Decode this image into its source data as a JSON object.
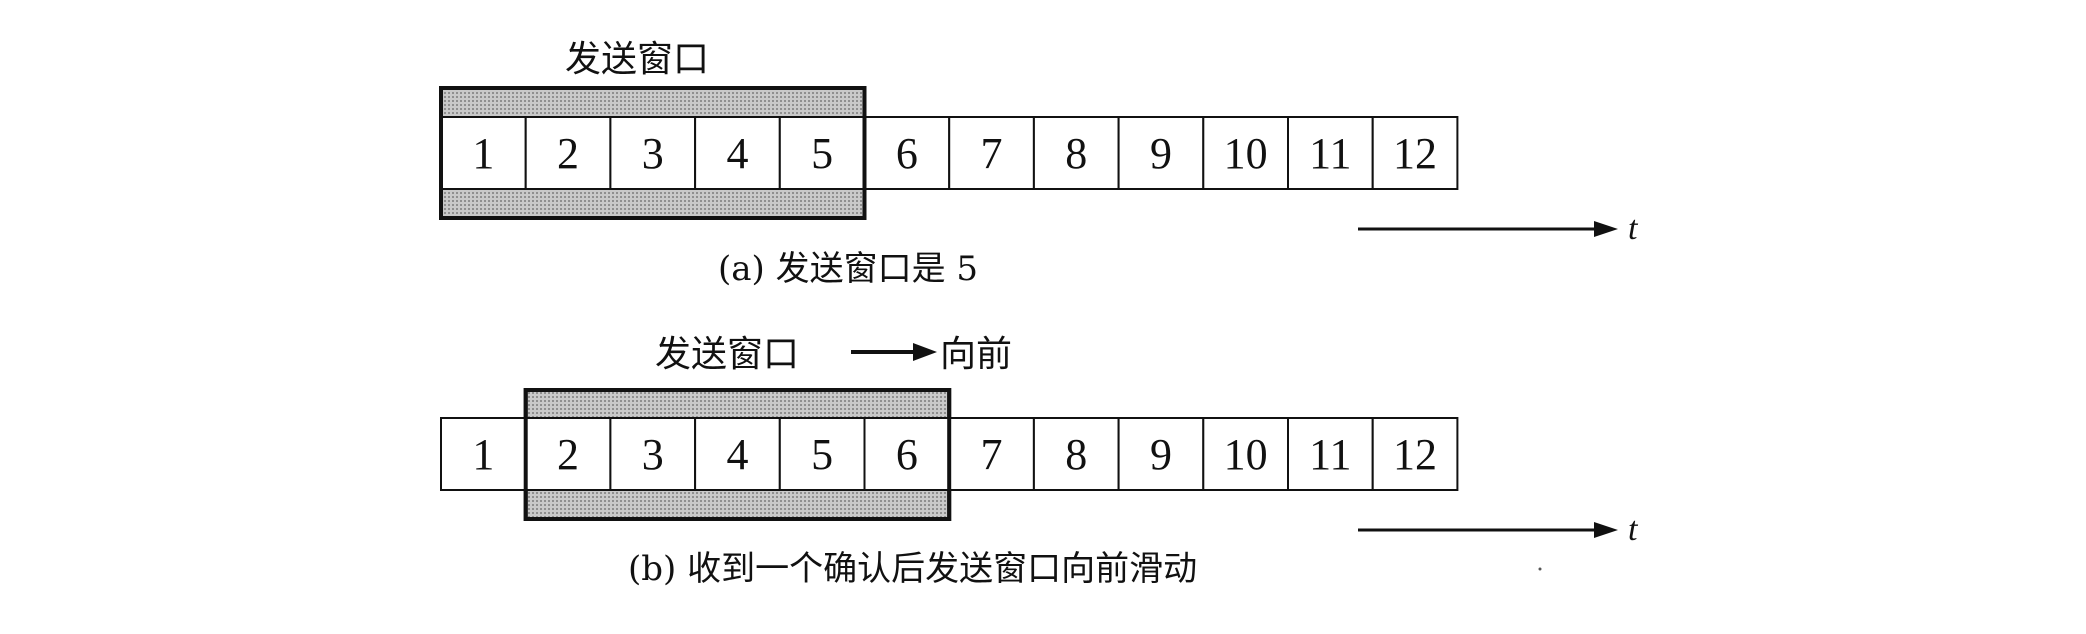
{
  "diagram_a": {
    "window_label": "发送窗口",
    "cells": [
      "1",
      "2",
      "3",
      "4",
      "5",
      "6",
      "7",
      "8",
      "9",
      "10",
      "11",
      "12"
    ],
    "window_start": 1,
    "window_end": 5,
    "time_label": "t",
    "caption": "(a) 发送窗口是 5"
  },
  "diagram_b": {
    "window_label": "发送窗口",
    "forward_label": "向前",
    "cells": [
      "1",
      "2",
      "3",
      "4",
      "5",
      "6",
      "7",
      "8",
      "9",
      "10",
      "11",
      "12"
    ],
    "window_start": 2,
    "window_end": 6,
    "time_label": "t",
    "caption": "(b) 收到一个确认后发送窗口向前滑动"
  },
  "colors": {
    "stroke": "#111111",
    "window_fill": "#b9b9b9"
  }
}
